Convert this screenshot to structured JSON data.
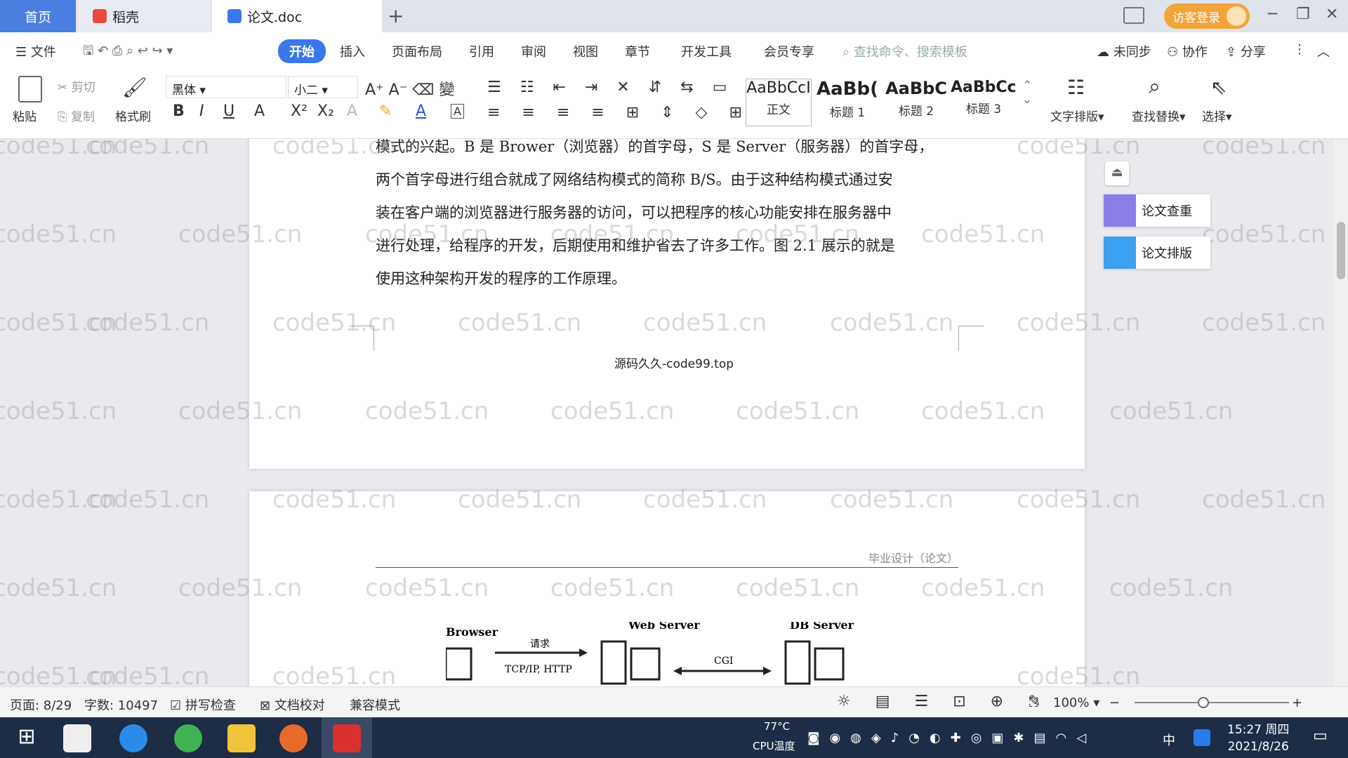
{
  "tabs": {
    "home": "首页",
    "docer": "稻壳",
    "doc": "论文.doc",
    "login": "访客登录"
  },
  "menu": {
    "file": "文件",
    "items": [
      "开始",
      "插入",
      "页面布局",
      "引用",
      "审阅",
      "视图",
      "章节",
      "开发工具",
      "会员专享"
    ],
    "search_placeholder": "查找命令、搜索模板",
    "sync": "未同步",
    "collab": "协作",
    "share": "分享"
  },
  "ribbon": {
    "paste": "粘贴",
    "cut": "剪切",
    "copy": "复制",
    "format_painter": "格式刷",
    "font": "黑体",
    "size": "小二",
    "styles": [
      {
        "sample": "AaBbCcI",
        "label": "正文"
      },
      {
        "sample": "AaBb(",
        "label": "标题 1"
      },
      {
        "sample": "AaBbC",
        "label": "标题 2"
      },
      {
        "sample": "AaBbCcl",
        "label": "标题 3"
      }
    ],
    "text_layout": "文字排版",
    "find_replace": "查找替换",
    "select": "选择"
  },
  "document": {
    "para": [
      "模式的兴起。B 是 Brower（浏览器）的首字母，S 是 Server（服务器）的首字母，",
      "两个首字母进行组合就成了网络结构模式的简称 B/S。由于这种结构模式通过安",
      "装在客户端的浏览器进行服务器的访问，可以把程序的核心功能安排在服务器中",
      "进行处理，给程序的开发，后期使用和维护省去了许多工作。图 2.1 展示的就是",
      "使用这种架构开发的程序的工作原理。"
    ],
    "footer": "源码久久-code99.top",
    "header": "毕业设计（论文）",
    "diagram": {
      "browser": "Browser",
      "web_server": "Web Server",
      "db_server": "DB Server",
      "request": "请求",
      "protocol": "TCP/IP, HTTP",
      "cgi": "CGI"
    }
  },
  "watermark": "code51.cn",
  "side": {
    "check": "论文查重",
    "layout": "论文排版"
  },
  "status": {
    "page": "页面: 8/29",
    "words": "字数: 10497",
    "spell": "拼写检查",
    "proof": "文档校对",
    "compat": "兼容模式",
    "zoom": "100%"
  },
  "taskbar": {
    "temp": "77°C",
    "cpu": "CPU温度",
    "time": "15:27 周四",
    "date": "2021/8/26",
    "ime": "中"
  }
}
